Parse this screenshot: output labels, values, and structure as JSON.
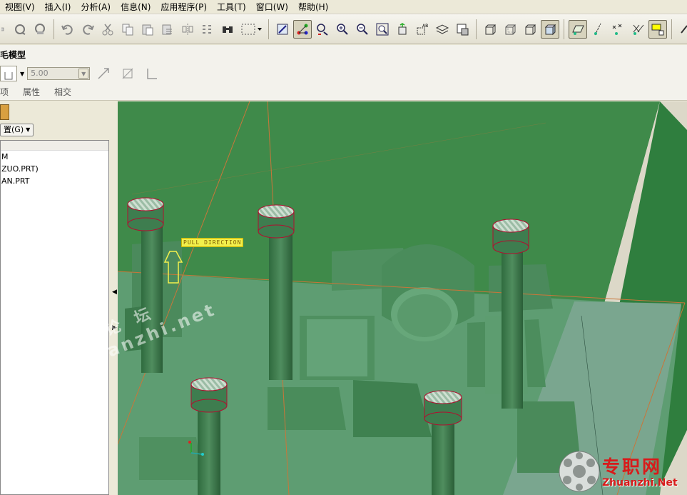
{
  "menu": {
    "items": [
      "视图(V)",
      "插入(I)",
      "分析(A)",
      "信息(N)",
      "应用程序(P)",
      "工具(T)",
      "窗口(W)",
      "帮助(H)"
    ]
  },
  "dashboard": {
    "title": "毛模型",
    "depth_value": "5.00",
    "tabs": [
      "项",
      "属性",
      "相交"
    ]
  },
  "tree": {
    "settings_label": "置(G)",
    "rows": [
      "M",
      "ZUO.PRT)",
      "AN.PRT"
    ]
  },
  "viewport": {
    "pull_direction_label": "PULL DIRECTION"
  },
  "watermark": {
    "chinese": "专职网论坛",
    "url": "bbs.zhuanzhi.net"
  },
  "logo": {
    "chinese": "专职网",
    "url": "Zhuanzhi.Net"
  },
  "colors": {
    "mold_dark": "#3f8a4a",
    "mold_mid": "#5e9d72",
    "pin_outline": "#b01030",
    "pull_label": "#f2ef4c"
  }
}
